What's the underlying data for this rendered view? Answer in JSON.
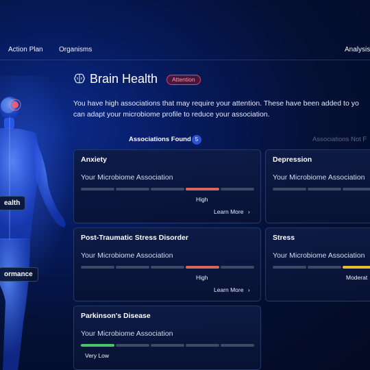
{
  "nav": {
    "items": [
      "Action Plan",
      "Organisms"
    ],
    "right_item": "Analysis"
  },
  "figure": {
    "labels": [
      "ealth",
      "ormance"
    ]
  },
  "header": {
    "title": "Brain Health",
    "badge": "Attention",
    "intro_line1": "You have high associations that may require your attention. These have been added to yo",
    "intro_line2": "can adapt your microbiome profile to reduce your association."
  },
  "tabs": {
    "found_label": "Associations Found",
    "found_count": "5",
    "not_found_label": "Associations Not F"
  },
  "colors": {
    "high": "#d9685a",
    "moderate": "#e6c02c",
    "very_low": "#4bc46a",
    "inactive": "#3e4a66",
    "badge_red": "#e04a4a",
    "accent_blue": "#2d4fd6"
  },
  "cards": [
    {
      "title": "Anxiety",
      "subtitle": "Your Microbiome Association",
      "level": "High",
      "level_index": 4,
      "link": "Learn More",
      "chevron": "chevron-right-icon"
    },
    {
      "title": "Depression",
      "subtitle": "Your Microbiome Association",
      "level": "",
      "level_index": 0,
      "link": ""
    },
    {
      "title": "Post-Traumatic Stress Disorder",
      "subtitle": "Your Microbiome Association",
      "level": "High",
      "level_index": 4,
      "link": "Learn More",
      "chevron": "chevron-right-icon"
    },
    {
      "title": "Stress",
      "subtitle": "Your Microbiome Association",
      "level": "Moderat",
      "level_index": 3,
      "link": ""
    },
    {
      "title": "Parkinson's Disease",
      "subtitle": "Your Microbiome Association",
      "level": "Very Low",
      "level_index": 1,
      "link": ""
    }
  ]
}
